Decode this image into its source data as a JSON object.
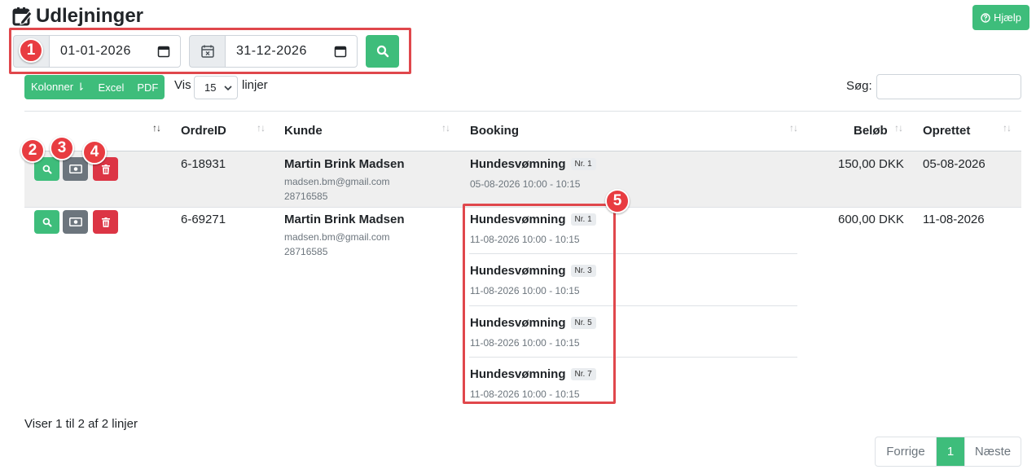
{
  "header": {
    "title": "Udlejninger",
    "help_label": "Hjælp"
  },
  "filter": {
    "from_date": "01-01-2026",
    "to_date": "31-12-2026"
  },
  "toolbar": {
    "columns_label": "Kolonner ⇂",
    "excel_label": "Excel",
    "pdf_label": "PDF",
    "show_label": "Vis",
    "page_size": "15",
    "lines_label": "linjer",
    "search_label": "Søg:"
  },
  "table": {
    "headers": {
      "order_id": "OrdreID",
      "customer": "Kunde",
      "booking": "Booking",
      "amount": "Beløb",
      "created": "Oprettet"
    },
    "rows": [
      {
        "order_id": "6-18931",
        "customer_name": "Martin Brink Madsen",
        "email": "madsen.bm@gmail.com",
        "phone": "28716585",
        "bookings": [
          {
            "title": "Hundesvømning",
            "nr": "Nr. 1",
            "time": "05-08-2026 10:00 - 10:15"
          }
        ],
        "amount": "150,00 DKK",
        "created": "05-08-2026"
      },
      {
        "order_id": "6-69271",
        "customer_name": "Martin Brink Madsen",
        "email": "madsen.bm@gmail.com",
        "phone": "28716585",
        "bookings": [
          {
            "title": "Hundesvømning",
            "nr": "Nr. 1",
            "time": "11-08-2026 10:00 - 10:15"
          },
          {
            "title": "Hundesvømning",
            "nr": "Nr. 3",
            "time": "11-08-2026 10:00 - 10:15"
          },
          {
            "title": "Hundesvømning",
            "nr": "Nr. 5",
            "time": "11-08-2026 10:00 - 10:15"
          },
          {
            "title": "Hundesvømning",
            "nr": "Nr. 7",
            "time": "11-08-2026 10:00 - 10:15"
          }
        ],
        "amount": "600,00 DKK",
        "created": "11-08-2026"
      }
    ]
  },
  "footer": {
    "info": "Viser 1 til 2 af 2 linjer",
    "prev": "Forrige",
    "page": "1",
    "next": "Næste"
  },
  "annotations": [
    "1",
    "2",
    "3",
    "4",
    "5"
  ],
  "colors": {
    "primary_green": "#3ebd7b",
    "danger_red": "#dc3545",
    "secondary_gray": "#6c757d",
    "annotation_red": "#e83c41"
  }
}
